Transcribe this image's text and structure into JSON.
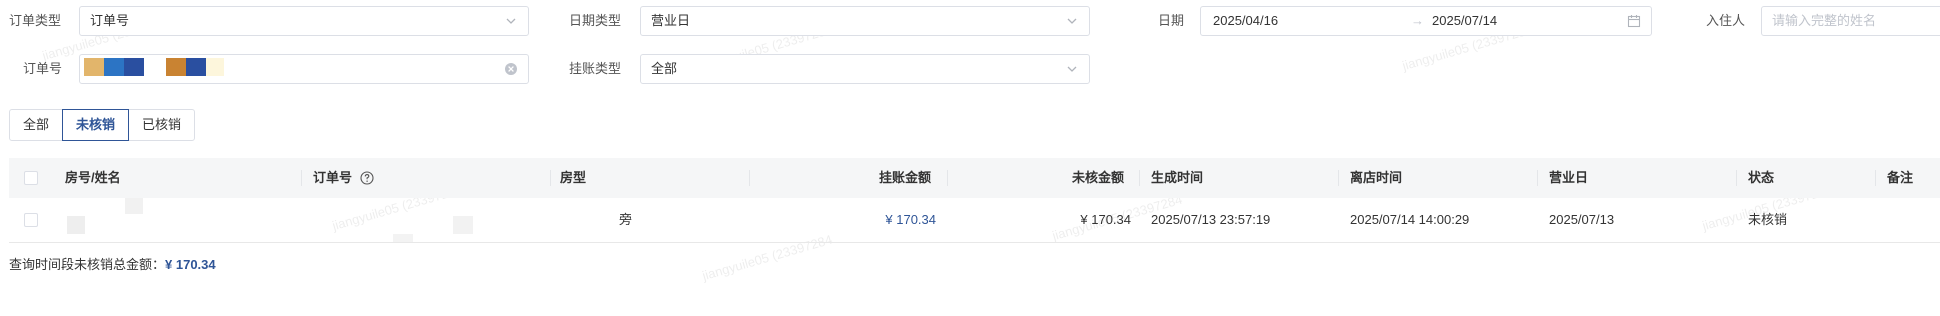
{
  "filters": {
    "order_type": {
      "label": "订单类型",
      "value": "订单号"
    },
    "date_type": {
      "label": "日期类型",
      "value": "营业日"
    },
    "date": {
      "label": "日期",
      "start": "2025/04/16",
      "arrow": "→",
      "end": "2025/07/14"
    },
    "guest": {
      "label": "入住人",
      "placeholder": "请输入完整的姓名"
    },
    "order_no": {
      "label": "订单号"
    },
    "account_type": {
      "label": "挂账类型",
      "value": "全部"
    }
  },
  "tabs": [
    {
      "label": "全部",
      "active": false
    },
    {
      "label": "未核销",
      "active": true
    },
    {
      "label": "已核销",
      "active": false
    }
  ],
  "table": {
    "columns": [
      "房号/姓名",
      "订单号",
      "房型",
      "挂账金额",
      "未核金额",
      "生成时间",
      "离店时间",
      "营业日",
      "状态",
      "备注"
    ],
    "rows": [
      {
        "room_name": "",
        "order_no": "",
        "room_type": "旁",
        "amount": "¥ 170.34",
        "unverified": "¥ 170.34",
        "created": "2025/07/13 23:57:19",
        "checkout": "2025/07/14 14:00:29",
        "business_day": "2025/07/13",
        "status": "未核销",
        "remark": ""
      }
    ]
  },
  "summary": {
    "label": "查询时间段未核销总金额：",
    "amount": "¥ 170.34"
  },
  "watermark": "jiangyuile05 (23397284",
  "colors": {
    "primary": "#2f5597",
    "amount_link": "#2f5597"
  }
}
